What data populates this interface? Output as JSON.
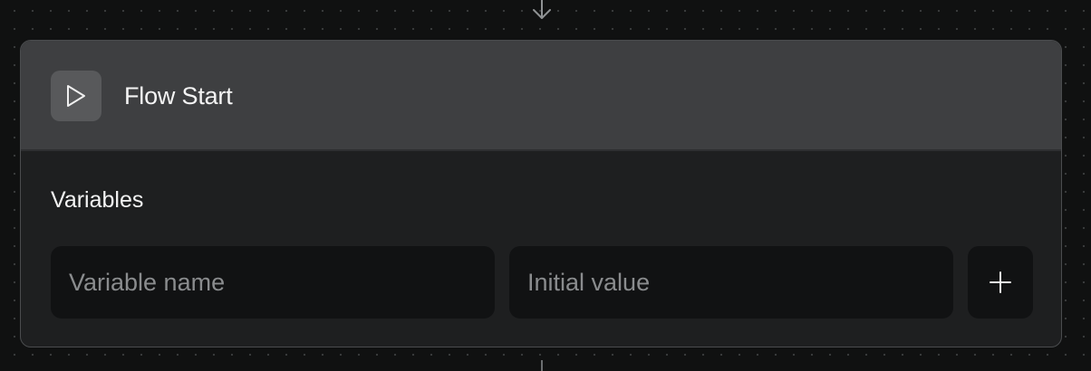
{
  "node": {
    "title": "Flow Start",
    "icon": "play-icon"
  },
  "variables": {
    "label": "Variables",
    "name_input": {
      "placeholder": "Variable name",
      "value": ""
    },
    "value_input": {
      "placeholder": "Initial value",
      "value": ""
    },
    "add_icon": "plus-icon"
  },
  "connectors": {
    "top_icon": "arrow-down-icon"
  },
  "colors": {
    "canvas": "#101111",
    "header": "#3e3f41",
    "body": "#1e1f20",
    "input": "#111213",
    "text": "#f4f4f4",
    "placeholder": "#8a8c8e"
  }
}
